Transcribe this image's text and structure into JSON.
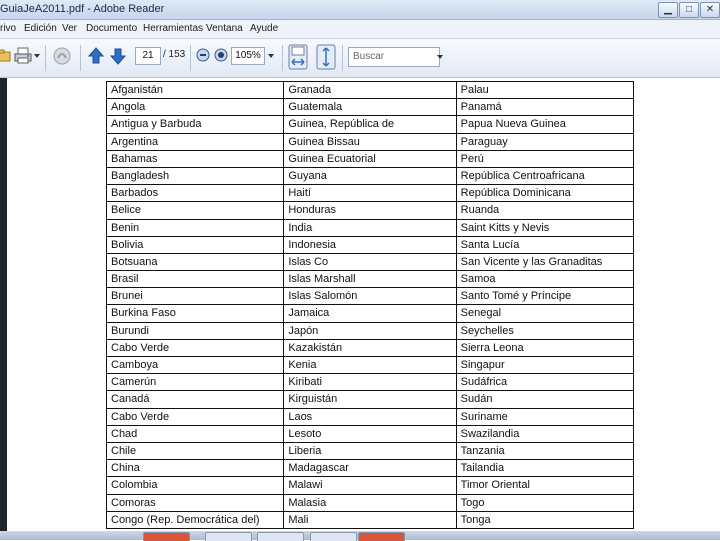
{
  "window": {
    "title": "GuiaJeA2011.pdf - Adobe Reader"
  },
  "menubar": {
    "items": [
      "rivo",
      "Edición",
      "Ver",
      "Documento",
      "Herramientas",
      "Ventana",
      "Ayude"
    ]
  },
  "toolbar": {
    "current_page": "21",
    "page_count": "/ 153",
    "zoom": "105%",
    "search_placeholder": "Buscar",
    "icons": [
      "open-folder-icon",
      "print-icon",
      "sign-icon",
      "previous-page-icon",
      "next-page-icon",
      "zoom-out-icon",
      "zoom-in-icon",
      "save-disk-icon",
      "fit-page-icon",
      "search-dropdown-icon"
    ]
  },
  "document": {
    "rows": [
      [
        "Afganistán",
        "Granada",
        "Palau"
      ],
      [
        "Angola",
        "Guatemala",
        "Panamá"
      ],
      [
        "Antigua y Barbuda",
        "Guinea, República de",
        "Papua Nueva Guinea"
      ],
      [
        "Argentina",
        "Guinea Bissau",
        "Paraguay"
      ],
      [
        "Bahamas",
        "Guinea Ecuatorial",
        "Perú"
      ],
      [
        "Bangladesh",
        "Guyana",
        "República Centroafricana"
      ],
      [
        "Barbados",
        "Haití",
        "República Dominicana"
      ],
      [
        "Belice",
        "Honduras",
        "Ruanda"
      ],
      [
        "Benin",
        "India",
        "Saint Kitts y Nevis"
      ],
      [
        "Bolivia",
        "Indonesia",
        "Santa Lucía"
      ],
      [
        "Botsuana",
        "Islas Co",
        "San Vicente y las Granaditas"
      ],
      [
        "Brasil",
        "Islas Marshall",
        "Samoa"
      ],
      [
        "Brunei",
        "Islas Salomón",
        "Santo Tomé y Príncipe"
      ],
      [
        "Burkina Faso",
        "Jamaica",
        "Senegal"
      ],
      [
        "Burundi",
        "Japón",
        "Seychelles"
      ],
      [
        "Cabo Verde",
        "Kazakistán",
        "Sierra Leona"
      ],
      [
        "Camboya",
        "Kenia",
        "Singapur"
      ],
      [
        "Camerún",
        "Kiribati",
        "Sudáfrica"
      ],
      [
        "Canadá",
        "Kirguistán",
        "Sudán"
      ],
      [
        "Cabo Verde",
        "Laos",
        "Suriname"
      ],
      [
        "Chad",
        "Lesoto",
        "Swazilandia"
      ],
      [
        "Chile",
        "Liberia",
        "Tanzania"
      ],
      [
        "China",
        "Madagascar",
        "Tailandia"
      ],
      [
        "Colombia",
        "Malawi",
        "Timor Oriental"
      ],
      [
        "Comoras",
        "Malasia",
        "Togo"
      ],
      [
        "Congo (Rep. Democrática del)",
        "Mali",
        "Tonga"
      ]
    ]
  },
  "colors": {
    "left_pane": "#20252c",
    "toolbar_bg": "#e8eef7",
    "arrow_blue": "#2f6fc4"
  }
}
